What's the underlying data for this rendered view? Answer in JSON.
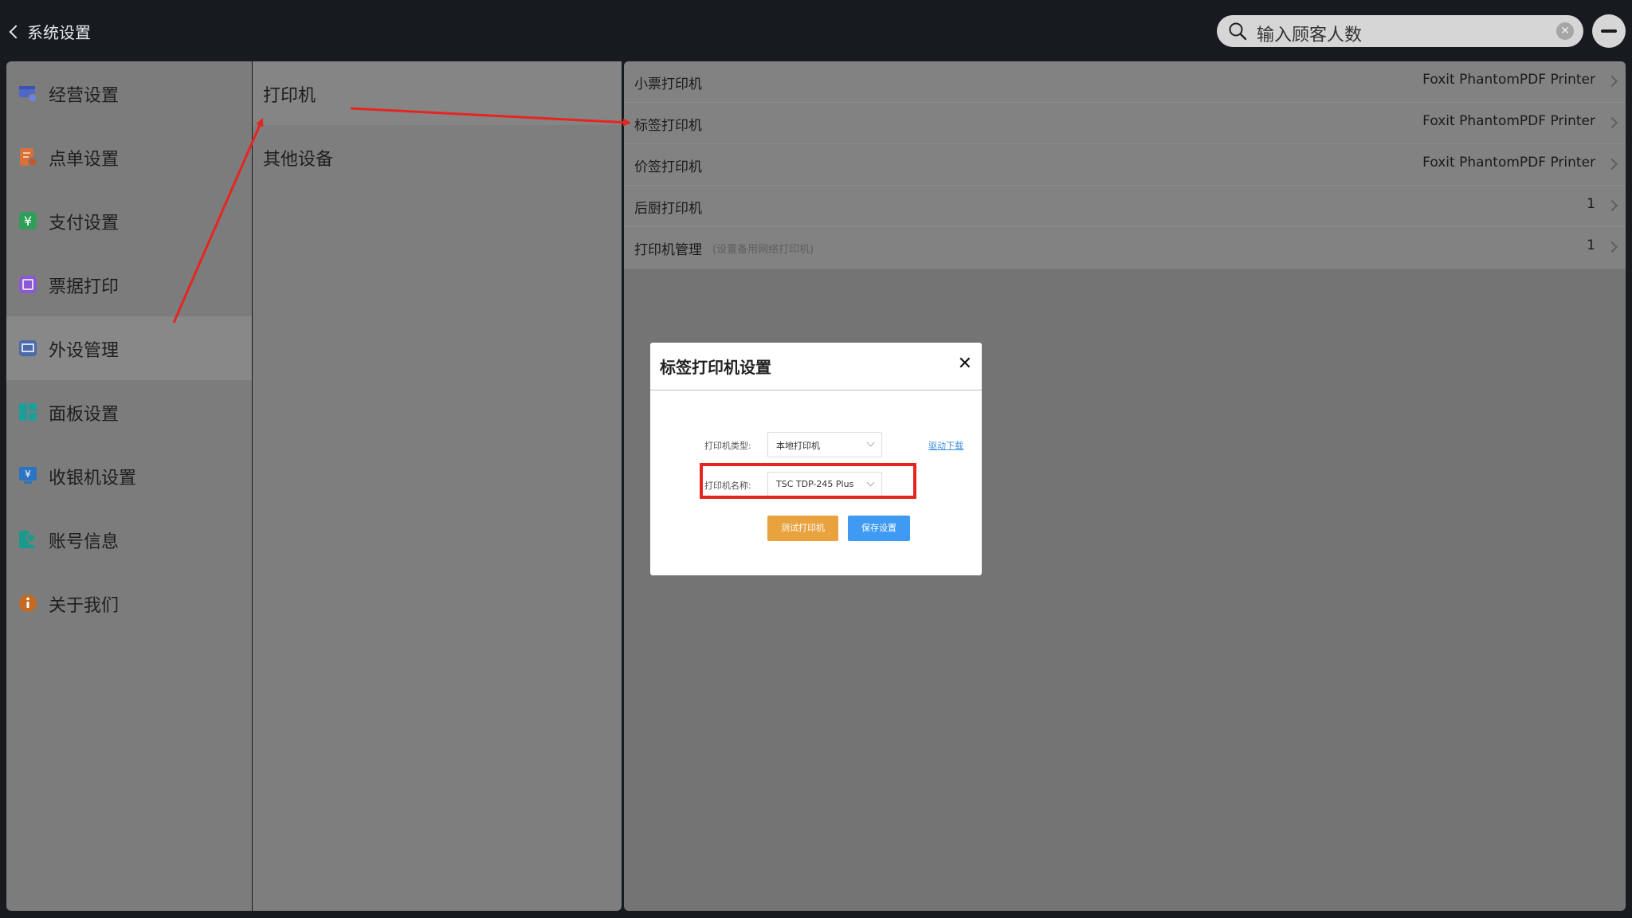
{
  "header": {
    "back_label": "系统设置",
    "search_placeholder": "输入顾客人数"
  },
  "sidebar": {
    "items": [
      {
        "label": "经营设置",
        "icon": "store-settings-icon"
      },
      {
        "label": "点单设置",
        "icon": "order-settings-icon"
      },
      {
        "label": "支付设置",
        "icon": "payment-yen-icon"
      },
      {
        "label": "票据打印",
        "icon": "receipt-print-icon"
      },
      {
        "label": "外设管理",
        "icon": "peripheral-monitor-icon"
      },
      {
        "label": "面板设置",
        "icon": "panel-layout-icon"
      },
      {
        "label": "收银机设置",
        "icon": "cashier-yen-icon"
      },
      {
        "label": "账号信息",
        "icon": "account-info-icon"
      },
      {
        "label": "关于我们",
        "icon": "info-icon"
      }
    ],
    "active_index": 4
  },
  "device_menu": {
    "items": [
      {
        "label": "打印机"
      },
      {
        "label": "其他设备"
      }
    ],
    "active_index": 0
  },
  "printers": {
    "rows": [
      {
        "label": "小票打印机",
        "value": "Foxit PhantomPDF Printer"
      },
      {
        "label": "标签打印机",
        "value": "Foxit PhantomPDF Printer"
      },
      {
        "label": "价签打印机",
        "value": "Foxit PhantomPDF Printer"
      },
      {
        "label": "后厨打印机",
        "value": "1"
      },
      {
        "label": "打印机管理",
        "hint": "(设置备用网络打印机)",
        "value": "1"
      }
    ]
  },
  "dialog": {
    "title": "标签打印机设置",
    "close": "✕",
    "type_label": "打印机类型:",
    "type_value": "本地打印机",
    "driver_link": "驱动下载",
    "name_label": "打印机名称:",
    "name_value": "TSC TDP-245 Plus",
    "test_button": "测试打印机",
    "save_button": "保存设置"
  },
  "colors": {
    "annotation_red": "#e52520",
    "test_button": "#e8a23e",
    "save_button": "#3e9af2",
    "link_blue": "#3e8fe0"
  }
}
